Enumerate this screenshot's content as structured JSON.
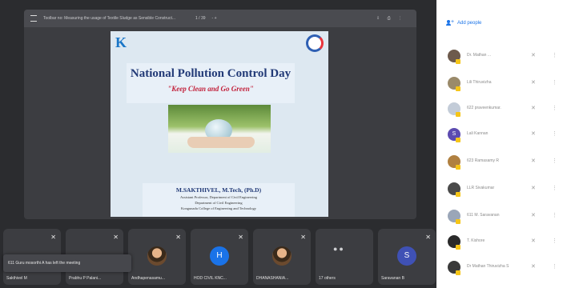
{
  "presentation": {
    "doc_title": "Toolbar no: Measuring the usage of Textile Sludge as Sensible Construct...",
    "page_indicator": "1 / 39",
    "zoom_controls": "-  +",
    "right_icons": "⇩ ⎙ ⋮",
    "slide": {
      "logo_text": "K",
      "title": "National Pollution Control Day",
      "subtitle": "\"Keep Clean and Go Green\"",
      "speaker_name": "M.SAKTHIVEL, M.Tech, (Ph.D)",
      "speaker_lines": [
        "Assistant Professor, Department of Civil Engineering",
        "Department of Civil Engineering",
        "Kongunadu College of Engineering and Technology"
      ]
    }
  },
  "participants_strip": [
    {
      "label": "Sakthivel M",
      "type": "blank"
    },
    {
      "label": "Prabhu P Palani...",
      "type": "blank"
    },
    {
      "label": "Andhapenasamu...",
      "type": "photo"
    },
    {
      "label": "HOD CIVIL KNC...",
      "type": "letter",
      "letter": "H",
      "color": "#1a73e8"
    },
    {
      "label": "DHANASHANIA...",
      "type": "photo"
    },
    {
      "label": "17 others",
      "type": "others"
    },
    {
      "label": "Saravanan B",
      "type": "letter",
      "letter": "S",
      "color": "#3f51b5"
    }
  ],
  "toast": "611 Guru mosorthi A has left the meeting",
  "panel": {
    "add_people": "Add people",
    "people": [
      {
        "name": "Dr. Mathan ...",
        "avatar_color": "#6d5a4c"
      },
      {
        "name": "Lili Thiruvizha",
        "avatar_color": "#9a8a6a"
      },
      {
        "name": "622 praveenkumar.",
        "avatar_color": "#c3ccd8"
      },
      {
        "name": "Lali Kannan",
        "avatar_color": "#5c4bb0",
        "letter": "S"
      },
      {
        "name": "623 Ramasamy R",
        "avatar_color": "#b08040"
      },
      {
        "name": "LLR Sivakumar",
        "avatar_color": "#4a4a4a"
      },
      {
        "name": "611 M. Saravanan",
        "avatar_color": "#9aa6b8"
      },
      {
        "name": "T. Kishore",
        "avatar_color": "#2a2a2a"
      },
      {
        "name": "Dr Mathan Thiruvizha S",
        "avatar_color": "#3a3a3a"
      }
    ]
  },
  "icons": {
    "mic_off": "mic-off-icon",
    "more": "more-vert-icon",
    "add_person": "person-add-icon",
    "menu": "menu-icon"
  }
}
